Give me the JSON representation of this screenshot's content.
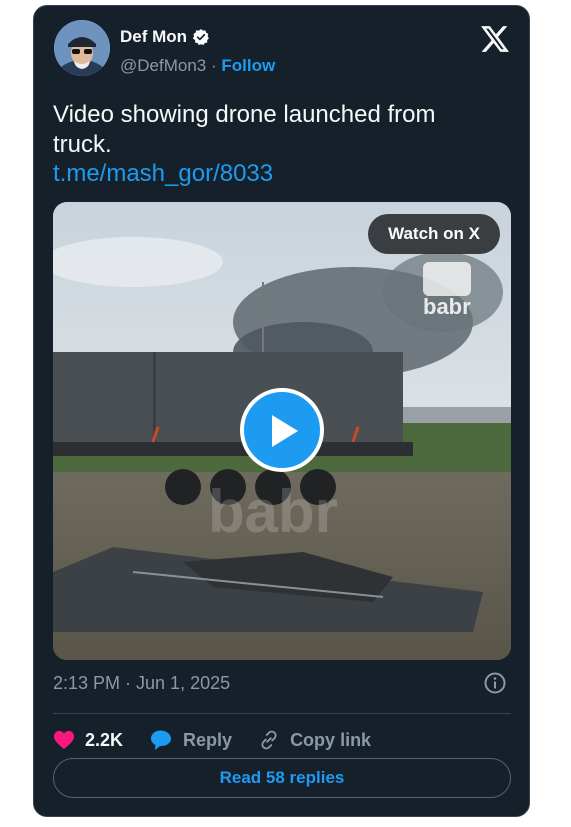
{
  "author": {
    "name": "Def Mon",
    "handle": "@DefMon3",
    "separator": "·",
    "follow_label": "Follow",
    "verified": true
  },
  "tweet": {
    "text": "Video showing drone launched from truck.",
    "link": "t.me/mash_gor/8033"
  },
  "media": {
    "watch_label": "Watch on X",
    "watermark_top": "babr",
    "watermark_center": "babr"
  },
  "meta": {
    "timestamp": "2:13 PM · Jun 1, 2025"
  },
  "actions": {
    "like_count": "2.2K",
    "reply_label": "Reply",
    "copy_link_label": "Copy link"
  },
  "footer": {
    "read_replies_label": "Read 58 replies"
  },
  "colors": {
    "background": "#15202b",
    "accent": "#1d9bf0",
    "heart": "#f91880",
    "muted": "#8b98a5"
  },
  "icons": [
    "verified-badge-icon",
    "x-logo-icon",
    "play-icon",
    "info-icon",
    "heart-icon",
    "reply-bubble-icon",
    "link-icon"
  ]
}
